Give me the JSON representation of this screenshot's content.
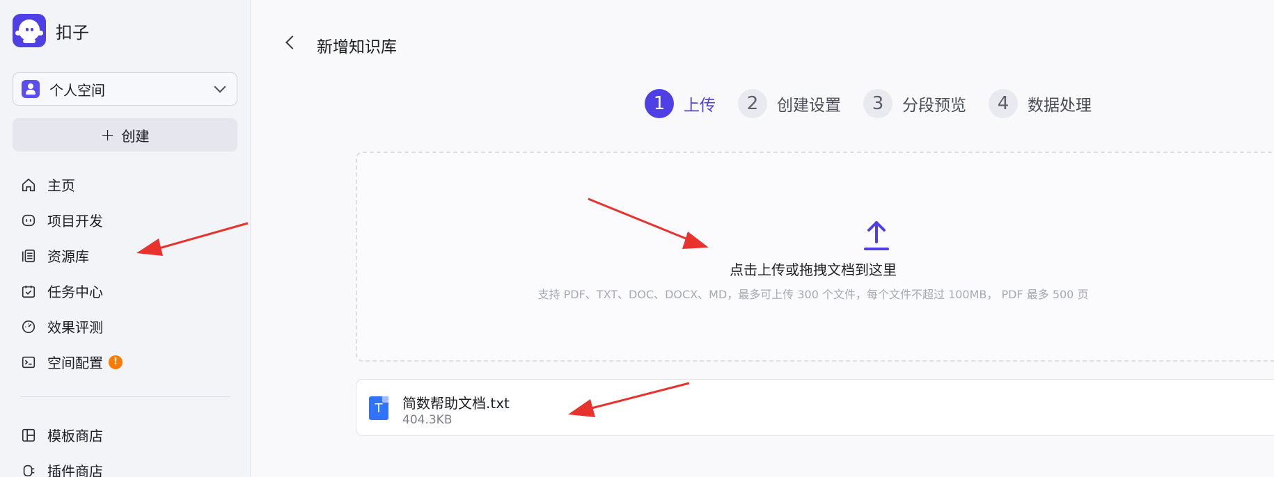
{
  "app": {
    "name": "扣子"
  },
  "sidebar": {
    "workspace_label": "个人空间",
    "create_label": "创建",
    "items": [
      {
        "label": "主页",
        "icon": "home-icon"
      },
      {
        "label": "项目开发",
        "icon": "project-icon"
      },
      {
        "label": "资源库",
        "icon": "library-icon"
      },
      {
        "label": "任务中心",
        "icon": "task-icon"
      },
      {
        "label": "效果评测",
        "icon": "gauge-icon"
      },
      {
        "label": "空间配置",
        "icon": "terminal-icon",
        "badge": "!"
      }
    ],
    "items2": [
      {
        "label": "模板商店",
        "icon": "template-icon"
      },
      {
        "label": "插件商店",
        "icon": "plugin-icon"
      }
    ]
  },
  "main": {
    "title": "新增知识库",
    "steps": [
      {
        "num": "1",
        "label": "上传",
        "active": true
      },
      {
        "num": "2",
        "label": "创建设置"
      },
      {
        "num": "3",
        "label": "分段预览"
      },
      {
        "num": "4",
        "label": "数据处理"
      }
    ],
    "upload": {
      "title": "点击上传或拖拽文档到这里",
      "hint": "支持 PDF、TXT、DOC、DOCX、MD，最多可上传 300 个文件，每个文件不超过 100MB， PDF 最多 500 页"
    },
    "file": {
      "name": "简数帮助文档.txt",
      "size": "404.3KB",
      "type_letter": "T"
    }
  },
  "colors": {
    "accent": "#4e40e5",
    "arrow": "#e8322e",
    "badge": "#ff7a00"
  }
}
